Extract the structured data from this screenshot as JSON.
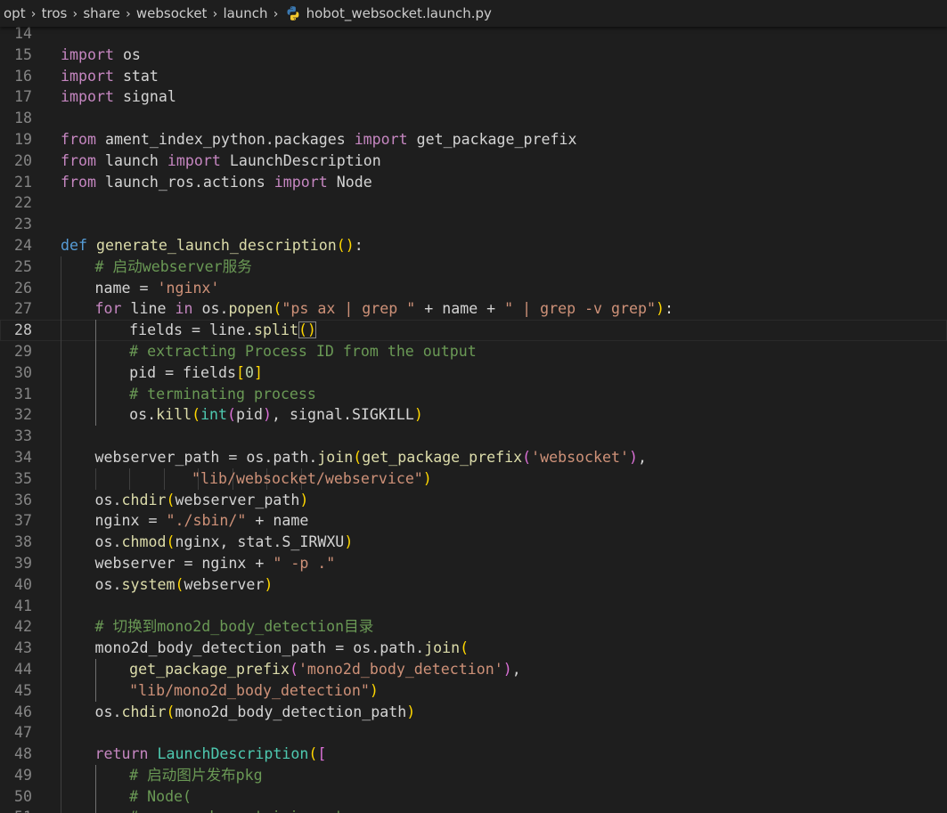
{
  "breadcrumbs": [
    {
      "label": "opt"
    },
    {
      "label": "tros"
    },
    {
      "label": "share"
    },
    {
      "label": "websocket"
    },
    {
      "label": "launch"
    }
  ],
  "file": {
    "name": "hobot_websocket.launch.py",
    "icon": "python-file-icon"
  },
  "colors": {
    "background": "#1e1e1e",
    "keyword": "#c586c0",
    "def_keyword": "#569cd6",
    "function": "#dcdcaa",
    "string": "#ce9178",
    "comment": "#6a9955",
    "number": "#b5cea8",
    "line_number": "#858585"
  },
  "editor": {
    "current_line": 28,
    "lines": [
      {
        "n": "14",
        "t": []
      },
      {
        "n": "15",
        "t": [
          [
            "kw",
            "import"
          ],
          [
            "plain",
            " os"
          ]
        ]
      },
      {
        "n": "16",
        "t": [
          [
            "kw",
            "import"
          ],
          [
            "plain",
            " stat"
          ]
        ]
      },
      {
        "n": "17",
        "t": [
          [
            "kw",
            "import"
          ],
          [
            "plain",
            " signal"
          ]
        ]
      },
      {
        "n": "18",
        "t": []
      },
      {
        "n": "19",
        "t": [
          [
            "kw",
            "from"
          ],
          [
            "plain",
            " ament_index_python.packages "
          ],
          [
            "kw",
            "import"
          ],
          [
            "plain",
            " get_package_prefix"
          ]
        ]
      },
      {
        "n": "20",
        "t": [
          [
            "kw",
            "from"
          ],
          [
            "plain",
            " launch "
          ],
          [
            "kw",
            "import"
          ],
          [
            "plain",
            " LaunchDescription"
          ]
        ]
      },
      {
        "n": "21",
        "t": [
          [
            "kw",
            "from"
          ],
          [
            "plain",
            " launch_ros.actions "
          ],
          [
            "kw",
            "import"
          ],
          [
            "plain",
            " Node"
          ]
        ]
      },
      {
        "n": "22",
        "t": []
      },
      {
        "n": "23",
        "t": []
      },
      {
        "n": "24",
        "t": [
          [
            "def",
            "def"
          ],
          [
            "plain",
            " "
          ],
          [
            "fn",
            "generate_launch_description"
          ],
          [
            "b1",
            "()"
          ],
          [
            "plain",
            ":"
          ]
        ]
      },
      {
        "n": "25",
        "g": 1,
        "t": [
          [
            "com",
            "# 启动webserver服务"
          ]
        ]
      },
      {
        "n": "26",
        "g": 1,
        "t": [
          [
            "plain",
            "name = "
          ],
          [
            "str",
            "'nginx'"
          ]
        ]
      },
      {
        "n": "27",
        "g": 1,
        "t": [
          [
            "kw",
            "for"
          ],
          [
            "plain",
            " line "
          ],
          [
            "kw",
            "in"
          ],
          [
            "plain",
            " os."
          ],
          [
            "fn",
            "popen"
          ],
          [
            "b1",
            "("
          ],
          [
            "str",
            "\"ps ax | grep \""
          ],
          [
            "plain",
            " + name + "
          ],
          [
            "str",
            "\" | grep -v grep\""
          ],
          [
            "b1",
            ")"
          ],
          [
            "plain",
            ":"
          ]
        ]
      },
      {
        "n": "28",
        "g": 2,
        "t": [
          [
            "plain",
            "fields = line."
          ],
          [
            "fn",
            "split"
          ],
          [
            "bm",
            "()"
          ]
        ]
      },
      {
        "n": "29",
        "g": 2,
        "t": [
          [
            "com",
            "# extracting Process ID from the output"
          ]
        ]
      },
      {
        "n": "30",
        "g": 2,
        "t": [
          [
            "plain",
            "pid = fields"
          ],
          [
            "b1",
            "["
          ],
          [
            "num",
            "0"
          ],
          [
            "b1",
            "]"
          ]
        ]
      },
      {
        "n": "31",
        "g": 2,
        "t": [
          [
            "com",
            "# terminating process"
          ]
        ]
      },
      {
        "n": "32",
        "g": 2,
        "t": [
          [
            "plain",
            "os."
          ],
          [
            "fn",
            "kill"
          ],
          [
            "b1",
            "("
          ],
          [
            "type",
            "int"
          ],
          [
            "b2",
            "("
          ],
          [
            "plain",
            "pid"
          ],
          [
            "b2",
            ")"
          ],
          [
            "plain",
            ", signal.SIGKILL"
          ],
          [
            "b1",
            ")"
          ]
        ]
      },
      {
        "n": "33",
        "g": 1,
        "t": []
      },
      {
        "n": "34",
        "g": 1,
        "t": [
          [
            "plain",
            "webserver_path = os.path."
          ],
          [
            "fn",
            "join"
          ],
          [
            "b1",
            "("
          ],
          [
            "fn",
            "get_package_prefix"
          ],
          [
            "b2",
            "("
          ],
          [
            "str",
            "'websocket'"
          ],
          [
            "b2",
            ")"
          ],
          [
            "plain",
            ","
          ]
        ]
      },
      {
        "n": "35",
        "g": 8,
        "t": [
          [
            "plain",
            "       "
          ],
          [
            "str",
            "\"lib/websocket/webservice\""
          ],
          [
            "b1",
            ")"
          ]
        ]
      },
      {
        "n": "36",
        "g": 1,
        "t": [
          [
            "plain",
            "os."
          ],
          [
            "fn",
            "chdir"
          ],
          [
            "b1",
            "("
          ],
          [
            "plain",
            "webserver_path"
          ],
          [
            "b1",
            ")"
          ]
        ]
      },
      {
        "n": "37",
        "g": 1,
        "t": [
          [
            "plain",
            "nginx = "
          ],
          [
            "str",
            "\"./sbin/\""
          ],
          [
            "plain",
            " + name"
          ]
        ]
      },
      {
        "n": "38",
        "g": 1,
        "t": [
          [
            "plain",
            "os."
          ],
          [
            "fn",
            "chmod"
          ],
          [
            "b1",
            "("
          ],
          [
            "plain",
            "nginx, stat.S_IRWXU"
          ],
          [
            "b1",
            ")"
          ]
        ]
      },
      {
        "n": "39",
        "g": 1,
        "t": [
          [
            "plain",
            "webserver = nginx + "
          ],
          [
            "str",
            "\" -p .\""
          ]
        ]
      },
      {
        "n": "40",
        "g": 1,
        "t": [
          [
            "plain",
            "os."
          ],
          [
            "fn",
            "system"
          ],
          [
            "b1",
            "("
          ],
          [
            "plain",
            "webserver"
          ],
          [
            "b1",
            ")"
          ]
        ]
      },
      {
        "n": "41",
        "g": 1,
        "t": []
      },
      {
        "n": "42",
        "g": 1,
        "t": [
          [
            "com",
            "# 切换到mono2d_body_detection目录"
          ]
        ]
      },
      {
        "n": "43",
        "g": 1,
        "t": [
          [
            "plain",
            "mono2d_body_detection_path = os.path."
          ],
          [
            "fn",
            "join"
          ],
          [
            "b1",
            "("
          ]
        ]
      },
      {
        "n": "44",
        "g": 2,
        "t": [
          [
            "fn",
            "get_package_prefix"
          ],
          [
            "b2",
            "("
          ],
          [
            "str",
            "'mono2d_body_detection'"
          ],
          [
            "b2",
            ")"
          ],
          [
            "plain",
            ","
          ]
        ]
      },
      {
        "n": "45",
        "g": 2,
        "t": [
          [
            "str",
            "\"lib/mono2d_body_detection\""
          ],
          [
            "b1",
            ")"
          ]
        ]
      },
      {
        "n": "46",
        "g": 1,
        "t": [
          [
            "plain",
            "os."
          ],
          [
            "fn",
            "chdir"
          ],
          [
            "b1",
            "("
          ],
          [
            "plain",
            "mono2d_body_detection_path"
          ],
          [
            "b1",
            ")"
          ]
        ]
      },
      {
        "n": "47",
        "g": 1,
        "t": []
      },
      {
        "n": "48",
        "g": 1,
        "t": [
          [
            "kw",
            "return"
          ],
          [
            "plain",
            " "
          ],
          [
            "type",
            "LaunchDescription"
          ],
          [
            "b1",
            "("
          ],
          [
            "b2",
            "["
          ]
        ]
      },
      {
        "n": "49",
        "g": 2,
        "t": [
          [
            "com",
            "# 启动图片发布pkg"
          ]
        ]
      },
      {
        "n": "50",
        "g": 2,
        "t": [
          [
            "com",
            "# Node("
          ]
        ]
      },
      {
        "n": "51",
        "g": 2,
        "t": [
          [
            "com",
            "#     package='mipi_cam',"
          ]
        ]
      }
    ]
  }
}
